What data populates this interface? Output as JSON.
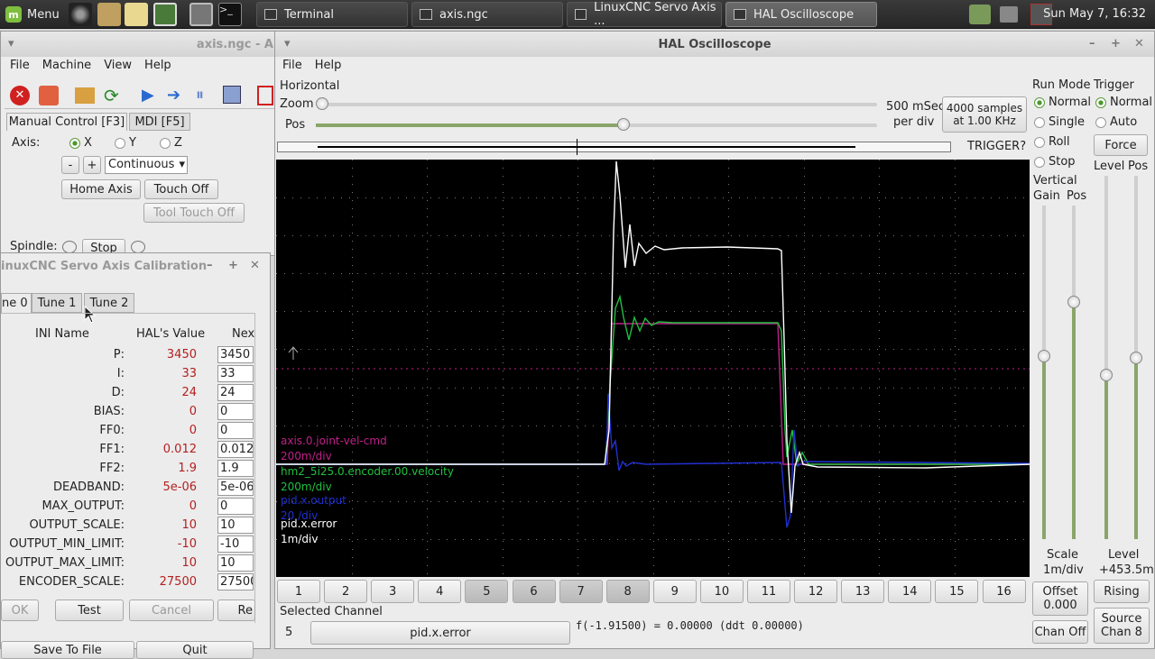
{
  "taskbar": {
    "menu_label": "Menu",
    "tasks": [
      {
        "label": "Terminal"
      },
      {
        "label": "axis.ngc"
      },
      {
        "label": "LinuxCNC Servo Axis ..."
      },
      {
        "label": "HAL Oscilloscope"
      }
    ],
    "clock": "Sun May  7, 16:32"
  },
  "axis": {
    "title": "axis.ngc - A",
    "menu": [
      "File",
      "Machine",
      "View",
      "Help"
    ],
    "tabs": [
      "Manual Control [F3]",
      "MDI [F5]"
    ],
    "axis_label": "Axis:",
    "axes": [
      "X",
      "Y",
      "Z"
    ],
    "selected_axis": "X",
    "minus": "-",
    "plus": "+",
    "jog_mode": "Continuous",
    "home_axis": "Home Axis",
    "touch_off": "Touch Off",
    "tool_touch_off": "Tool Touch Off",
    "spindle_label": "Spindle:",
    "spindle_stop": "Stop"
  },
  "calib": {
    "title": "inuxCNC Servo Axis Calibration",
    "tabs": [
      "ne 0",
      "Tune 1",
      "Tune 2"
    ],
    "headers": [
      "INI Name",
      "HAL's Value",
      "Nex"
    ],
    "rows": [
      {
        "name": "P:",
        "hal": "3450",
        "next": "3450"
      },
      {
        "name": "I:",
        "hal": "33",
        "next": "33"
      },
      {
        "name": "D:",
        "hal": "24",
        "next": "24"
      },
      {
        "name": "BIAS:",
        "hal": "0",
        "next": "0"
      },
      {
        "name": "FF0:",
        "hal": "0",
        "next": "0"
      },
      {
        "name": "FF1:",
        "hal": "0.012",
        "next": "0.012"
      },
      {
        "name": "FF2:",
        "hal": "1.9",
        "next": "1.9"
      },
      {
        "name": "DEADBAND:",
        "hal": "5e-06",
        "next": "5e-06"
      },
      {
        "name": "MAX_OUTPUT:",
        "hal": "0",
        "next": "0"
      },
      {
        "name": "OUTPUT_SCALE:",
        "hal": "10",
        "next": "10"
      },
      {
        "name": "OUTPUT_MIN_LIMIT:",
        "hal": "-10",
        "next": "-10"
      },
      {
        "name": "OUTPUT_MAX_LIMIT:",
        "hal": "10",
        "next": "10"
      },
      {
        "name": "ENCODER_SCALE:",
        "hal": "27500",
        "next": "27500"
      }
    ],
    "ok": "OK",
    "test": "Test",
    "cancel": "Cancel",
    "revert": "Re",
    "save": "Save To File",
    "quit": "Quit"
  },
  "scope": {
    "title": "HAL Oscilloscope",
    "menu": [
      "File",
      "Help"
    ],
    "horizontal": "Horizontal",
    "zoom": "Zoom",
    "pos": "Pos",
    "zoom_value": 0.0,
    "pos_value": 0.55,
    "time_div_1": "500 mSec",
    "time_div_2": "per div",
    "samples_1": "4000 samples",
    "samples_2": "at 1.00 KHz",
    "trigger_status": "TRIGGER?",
    "channels": [
      "1",
      "2",
      "3",
      "4",
      "5",
      "6",
      "7",
      "8",
      "9",
      "10",
      "11",
      "12",
      "13",
      "14",
      "15",
      "16"
    ],
    "traces": [
      {
        "name": "axis.0.joint-vel-cmd",
        "scale": "200m/div",
        "color": "#c0208a"
      },
      {
        "name": "hm2_5i25.0.encoder.00.velocity",
        "scale": "200m/div",
        "color": "#20c040"
      },
      {
        "name": "pid.x.output",
        "scale": "20 /div",
        "color": "#2030d0"
      },
      {
        "name": "pid.x.error",
        "scale": "1m/div",
        "color": "#ffffff"
      }
    ],
    "selected_channel_label": "Selected Channel",
    "selected_channel_num": "5",
    "selected_channel_name": "pid.x.error",
    "readout": "f(-1.91500) =  0.00000 (ddt  0.00000)",
    "run_mode": {
      "label": "Run Mode",
      "options": [
        "Normal",
        "Single",
        "Roll",
        "Stop"
      ],
      "selected": "Normal"
    },
    "trigger": {
      "label": "Trigger",
      "options": [
        "Normal",
        "Auto"
      ],
      "selected": "Normal",
      "force": "Force",
      "level": "Level",
      "pos": "Pos",
      "level_value": 0.45,
      "pos_value": 0.5
    },
    "vertical": {
      "label": "Vertical",
      "gain": "Gain",
      "pos": "Pos",
      "gain_value": 0.55,
      "pos_value": 0.72
    },
    "scale_label": "Scale",
    "scale_value": "1m/div",
    "level_label": "Level",
    "level_readout": "+453.5m",
    "offset_label": "Offset",
    "offset_value": "0.000",
    "rising": "Rising",
    "chan_off": "Chan Off",
    "source_1": "Source",
    "source_2": "Chan 8"
  }
}
